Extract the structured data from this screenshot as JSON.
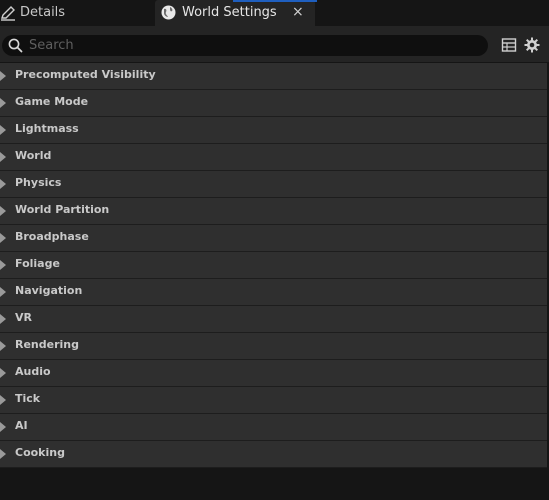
{
  "tabs": {
    "details_label": "Details",
    "world_label": "World Settings",
    "close_glyph": "×"
  },
  "search": {
    "placeholder": "Search",
    "value": ""
  },
  "categories": [
    {
      "label": "Precomputed Visibility"
    },
    {
      "label": "Game Mode"
    },
    {
      "label": "Lightmass"
    },
    {
      "label": "World"
    },
    {
      "label": "Physics"
    },
    {
      "label": "World Partition"
    },
    {
      "label": "Broadphase"
    },
    {
      "label": "Foliage"
    },
    {
      "label": "Navigation"
    },
    {
      "label": "VR"
    },
    {
      "label": "Rendering"
    },
    {
      "label": "Audio"
    },
    {
      "label": "Tick"
    },
    {
      "label": "AI"
    },
    {
      "label": "Cooking"
    }
  ],
  "icons": {
    "details_tab": "pencil-icon",
    "world_tab": "globe-icon",
    "search": "search-icon",
    "table_view": "table-view-icon",
    "settings": "gear-icon",
    "expand": "expand-arrow-icon"
  },
  "colors": {
    "background": "#151515",
    "panel": "#242424",
    "category_row": "#2f2f2f",
    "active_tab_accent": "#1f5fbf"
  }
}
